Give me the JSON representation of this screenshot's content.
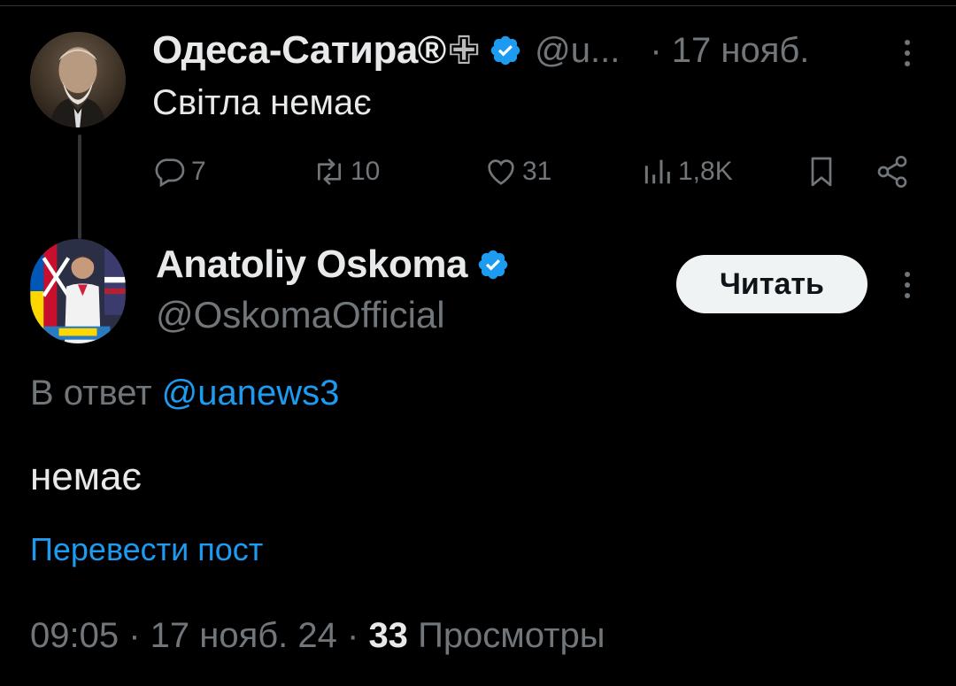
{
  "parent_post": {
    "author_name": "Одеса-Сатира®",
    "name_emoji": "✙",
    "handle": "@u...",
    "date": "· 17 нояб.",
    "text": "Світла немає",
    "actions": {
      "replies": "7",
      "reposts": "10",
      "likes": "31",
      "views": "1,8K"
    }
  },
  "reply_post": {
    "author_name": "Anatoliy Oskoma",
    "handle": "@OskomaOfficial",
    "follow_label": "Читать",
    "reply_prefix": "В ответ",
    "reply_to": "@uanews3",
    "text": "немає",
    "translate_label": "Перевести пост",
    "timestamp": "09:05 · 17 нояб. 24 ·",
    "views_count": "33",
    "views_label": "Просмотры"
  },
  "colors": {
    "background": "#000000",
    "text": "#e7e9ea",
    "muted": "#71767b",
    "link": "#1d9bf0",
    "verified": "#1d9bf0",
    "button_bg": "#eff3f4"
  },
  "icons": [
    "verified-badge-icon",
    "reply-icon",
    "repost-icon",
    "like-icon",
    "views-icon",
    "bookmark-icon",
    "share-icon",
    "more-icon"
  ]
}
